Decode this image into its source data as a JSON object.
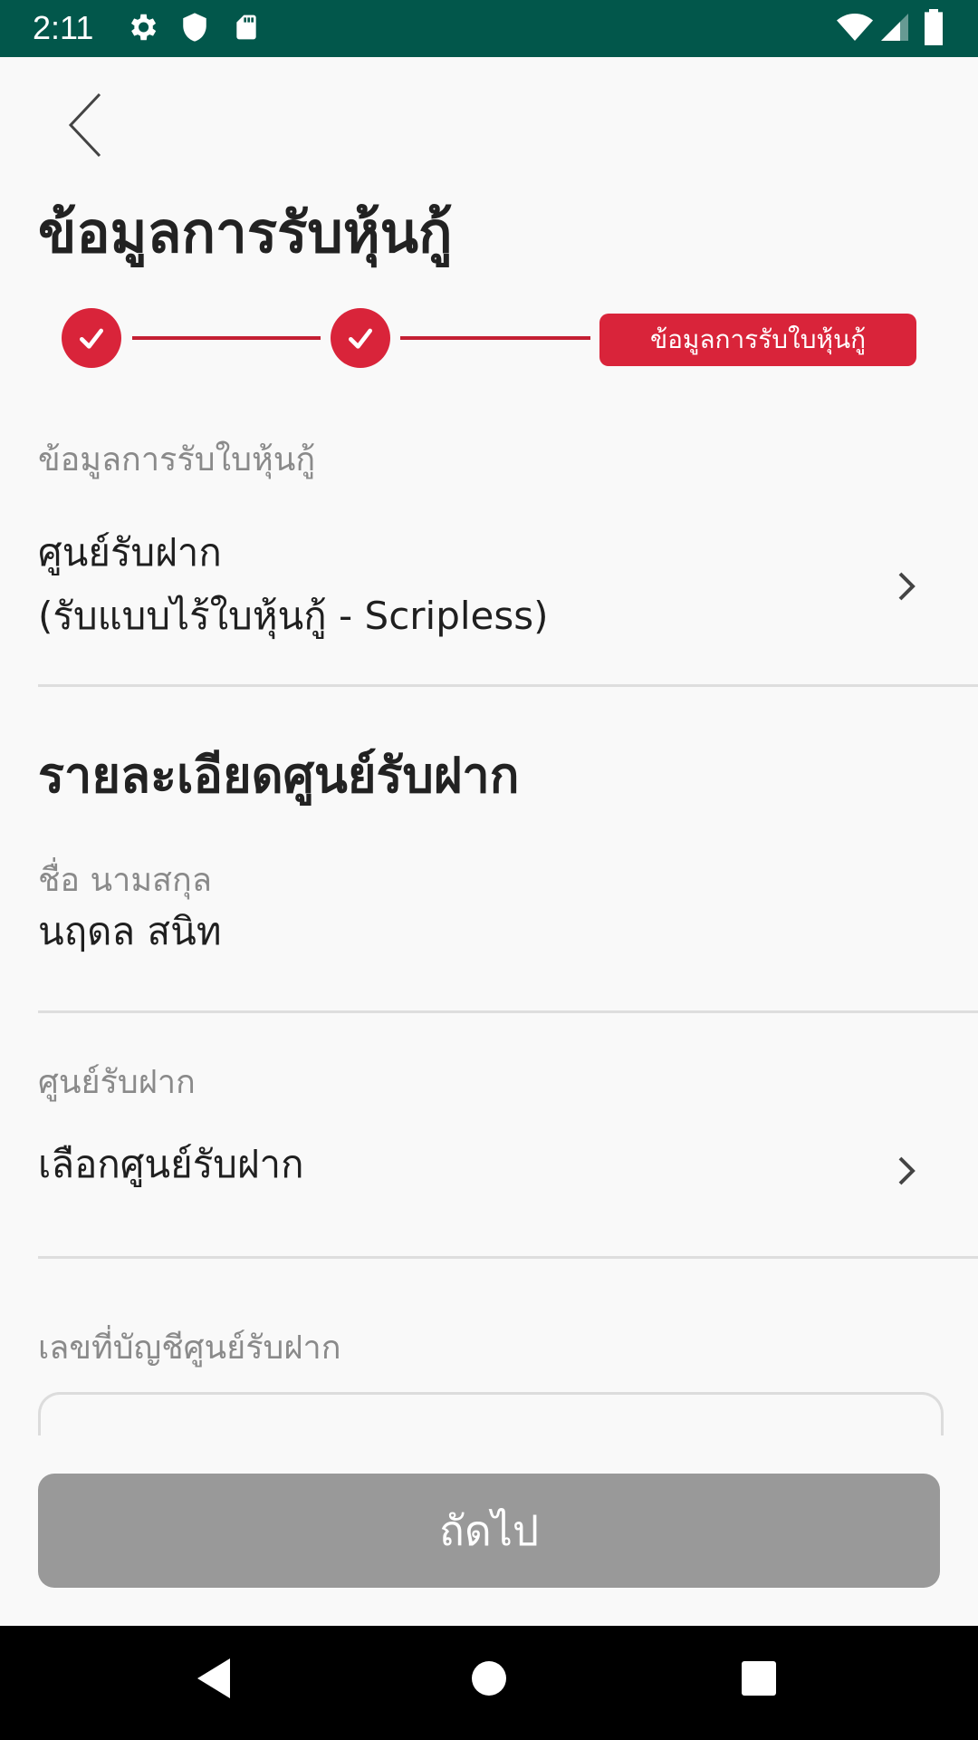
{
  "status_bar": {
    "time": "2:11"
  },
  "header": {
    "title": "ข้อมูลการรับหุ้นกู้"
  },
  "stepper": {
    "current_step_label": "ข้อมูลการรับใบหุ้นกู้"
  },
  "receipt": {
    "label": "ข้อมูลการรับใบหุ้นกู้",
    "value_line1": "ศูนย์รับฝาก",
    "value_line2": "(รับแบบไร้ใบหุ้นกู้ - Scripless)"
  },
  "depository": {
    "section_title": "รายละเอียดศูนย์รับฝาก",
    "name_label": "ชื่อ นามสกุล",
    "name_value": "นฤดล สนิท",
    "center_label": "ศูนย์รับฝาก",
    "center_value": "เลือกศูนย์รับฝาก",
    "account_label": "เลขที่บัญชีศูนย์รับฝาก"
  },
  "footer": {
    "next_label": "ถัดไป"
  },
  "colors": {
    "status_bar": "#02574b",
    "accent": "#d9243a",
    "disabled_button": "#999999"
  }
}
